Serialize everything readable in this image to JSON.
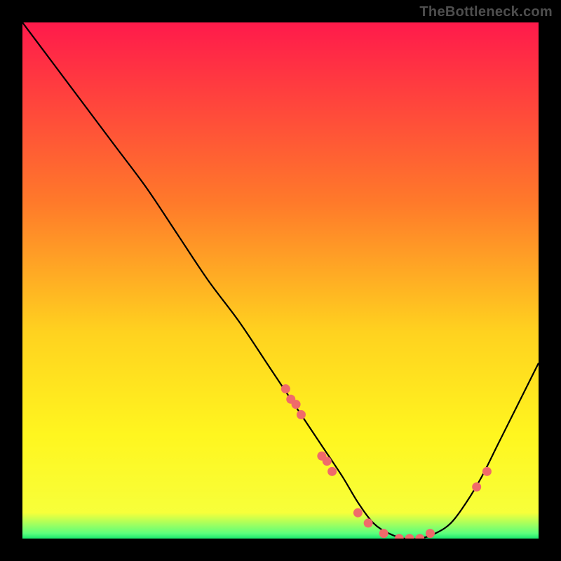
{
  "watermark": "TheBottleneck.com",
  "chart_data": {
    "type": "line",
    "title": "",
    "xlabel": "",
    "ylabel": "",
    "xlim": [
      0,
      100
    ],
    "ylim": [
      0,
      100
    ],
    "grid": false,
    "legend": false,
    "series": [
      {
        "name": "bottleneck-curve",
        "x": [
          0,
          6,
          12,
          18,
          24,
          30,
          36,
          42,
          48,
          54,
          58,
          62,
          65,
          68,
          71,
          74,
          77,
          80,
          83,
          86,
          89,
          92,
          95,
          98,
          100
        ],
        "y": [
          100,
          92,
          84,
          76,
          68,
          59,
          50,
          42,
          33,
          24,
          18,
          12,
          7,
          3,
          1,
          0,
          0,
          1,
          3,
          7,
          12,
          18,
          24,
          30,
          34
        ]
      }
    ],
    "scatter_points": {
      "name": "markers",
      "x": [
        51,
        52,
        53,
        54,
        58,
        59,
        60,
        65,
        67,
        70,
        73,
        75,
        77,
        79,
        88,
        90
      ],
      "y": [
        29,
        27,
        26,
        24,
        16,
        15,
        13,
        5,
        3,
        1,
        0,
        0,
        0,
        1,
        10,
        13
      ]
    },
    "gradient_stops": [
      {
        "offset": 0.0,
        "color": "#ff1a4b"
      },
      {
        "offset": 0.35,
        "color": "#ff7a2a"
      },
      {
        "offset": 0.6,
        "color": "#ffd21f"
      },
      {
        "offset": 0.8,
        "color": "#fff61f"
      },
      {
        "offset": 0.95,
        "color": "#f7ff3a"
      },
      {
        "offset": 0.99,
        "color": "#5cff7d"
      },
      {
        "offset": 1.0,
        "color": "#19e86e"
      }
    ],
    "marker_color": "#f06a6a",
    "curve_color": "#000000"
  }
}
